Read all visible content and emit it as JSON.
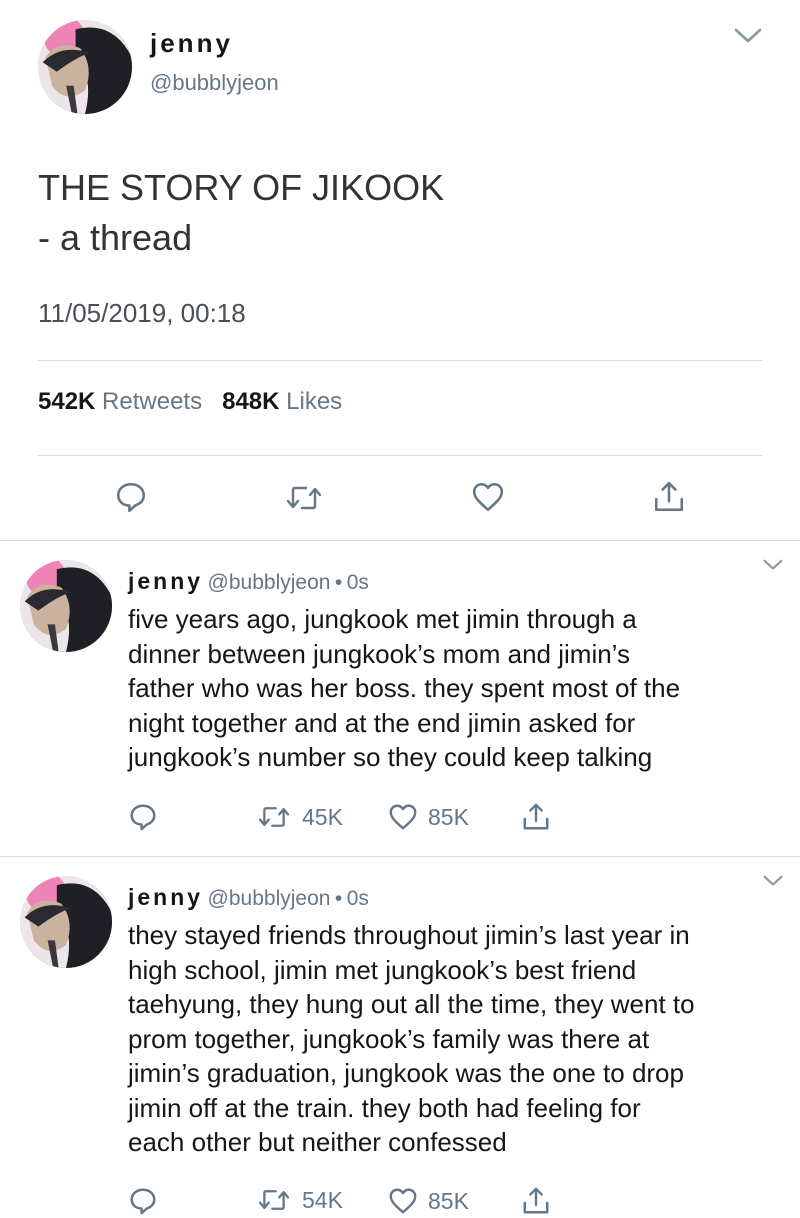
{
  "main_tweet": {
    "author_name": "jenny",
    "author_handle": "@bubblyjeon",
    "text_line1": "THE STORY OF JIKOOK",
    "text_line2": "- a thread",
    "timestamp": "11/05/2019, 00:18",
    "retweets_count": "542K",
    "retweets_label": "Retweets",
    "likes_count": "848K",
    "likes_label": "Likes"
  },
  "replies": [
    {
      "author_name": "jenny",
      "author_handle": "@bubblyjeon",
      "separator": "•",
      "time": "0s",
      "lines": [
        "five years ago, jungkook met jimin through a",
        "dinner between jungkook’s mom and jimin’s",
        "father who was her boss. they spent most of the",
        "night together and at the end jimin asked for",
        "jungkook’s number so they could keep talking"
      ],
      "retweets": "45K",
      "likes": "85K"
    },
    {
      "author_name": "jenny",
      "author_handle": "@bubblyjeon",
      "separator": "•",
      "time": "0s",
      "lines": [
        "they stayed friends throughout jimin’s last year in",
        "high school, jimin met jungkook’s best friend",
        "taehyung, they hung out all the time, they went to",
        "prom together, jungkook’s family was there at",
        "jimin’s graduation, jungkook was the one to drop",
        "jimin off at the train. they both had feeling for",
        "each other but neither confessed"
      ],
      "retweets": "54K",
      "likes": "85K"
    }
  ],
  "icons": {
    "reply": "reply-icon",
    "retweet": "retweet-icon",
    "like": "heart-icon",
    "share": "share-icon",
    "more": "chevron-down-icon"
  },
  "colors": {
    "text": "#14171a",
    "secondary": "#657786",
    "divider": "#d8dde2"
  }
}
